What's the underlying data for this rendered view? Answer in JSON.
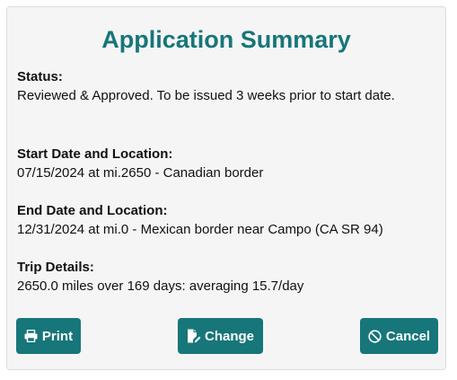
{
  "summary": {
    "title": "Application Summary",
    "sections": [
      {
        "heading": "Status:",
        "body": "Reviewed & Approved. To be issued 3 weeks prior to start date."
      },
      {
        "heading": "Start Date and Location:",
        "body": "07/15/2024 at mi.2650 - Canadian border"
      },
      {
        "heading": "End Date and Location:",
        "body": "12/31/2024 at mi.0 - Mexican border near Campo (CA SR 94)"
      },
      {
        "heading": "Trip Details:",
        "body": "2650.0 miles over 169 days: averaging 15.7/day"
      }
    ]
  },
  "actions": {
    "print_label": "Print",
    "print_icon": "printer-icon",
    "change_label": "Change",
    "change_icon": "edit-document-icon",
    "cancel_label": "Cancel",
    "cancel_icon": "ban-icon"
  },
  "colors": {
    "accent": "#177679",
    "card_background": "#f5f5f5",
    "text": "#111111"
  }
}
